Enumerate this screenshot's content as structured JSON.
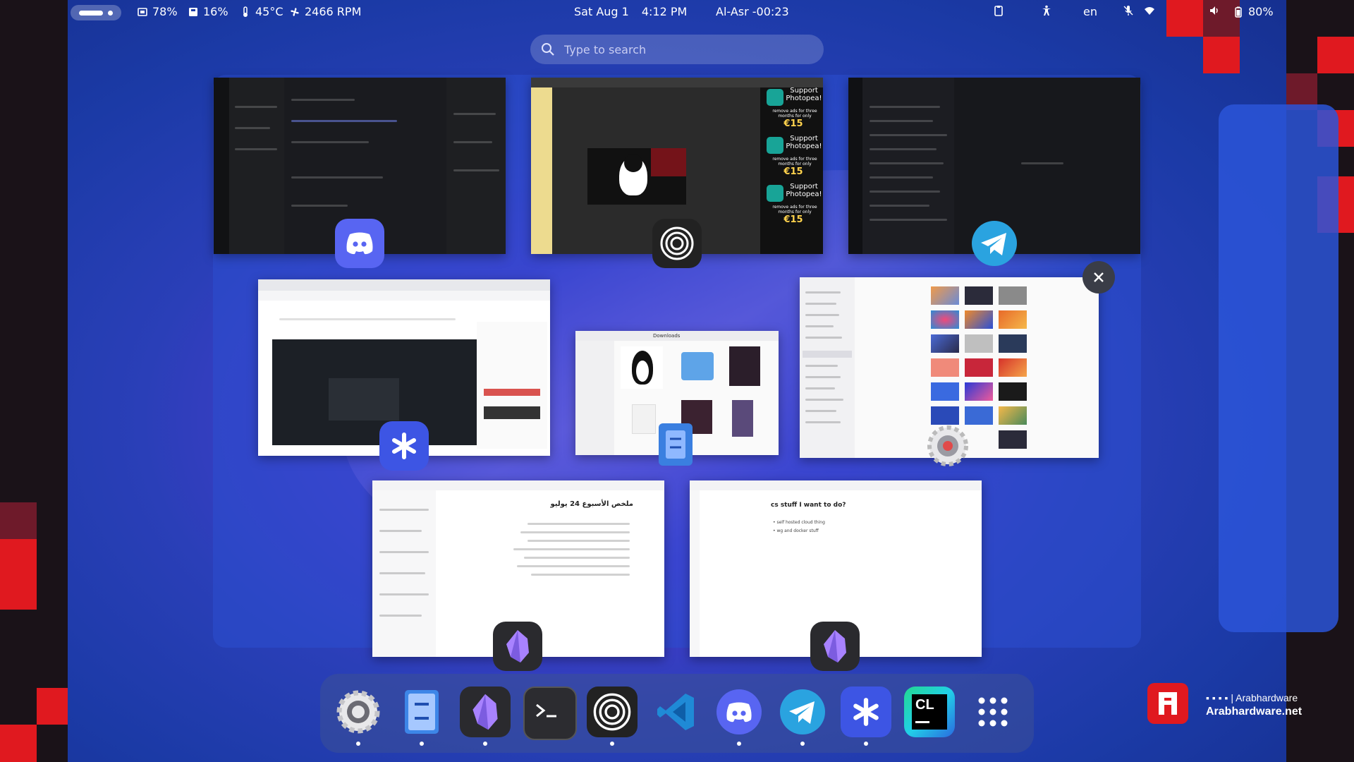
{
  "topbar": {
    "cpu": "78%",
    "disk": "16%",
    "temp": "45°C",
    "fan": "2466 RPM",
    "date": "Sat Aug 1",
    "time": "4:12 PM",
    "prayer": "Al-Asr -00:23",
    "language": "en",
    "battery": "80%"
  },
  "search": {
    "placeholder": "Type to search"
  },
  "windows": {
    "photopea_ads": [
      {
        "title": "Support Photopea!",
        "sub": "remove ads for three months for only",
        "price": "€15"
      },
      {
        "title": "Support Photopea!",
        "sub": "remove ads for three months for only",
        "price": "€15"
      },
      {
        "title": "Support Photopea!",
        "sub": "remove ads for three months for only",
        "price": "€15"
      }
    ],
    "notes_right_title": "cs stuff I want to do?",
    "notes_right_items": [
      "self hosted cloud thing",
      "wg and docker stuff"
    ],
    "notes_left_title": "ملخص الأسبوع 24 يوليو",
    "files_title": "Downloads"
  },
  "dock": {
    "items": [
      "settings-icon",
      "files-icon",
      "obsidian-icon",
      "terminal-icon",
      "obs-icon",
      "vscode-icon",
      "discord-icon",
      "telegram-icon",
      "slack-like-icon",
      "clion-icon",
      "app-grid-icon"
    ]
  },
  "watermark": {
    "line1": "Arabhardware",
    "line2": "Arabhardware.net"
  },
  "colors": {
    "accent": "#e0191f",
    "workspace": "#2a3fb8"
  }
}
